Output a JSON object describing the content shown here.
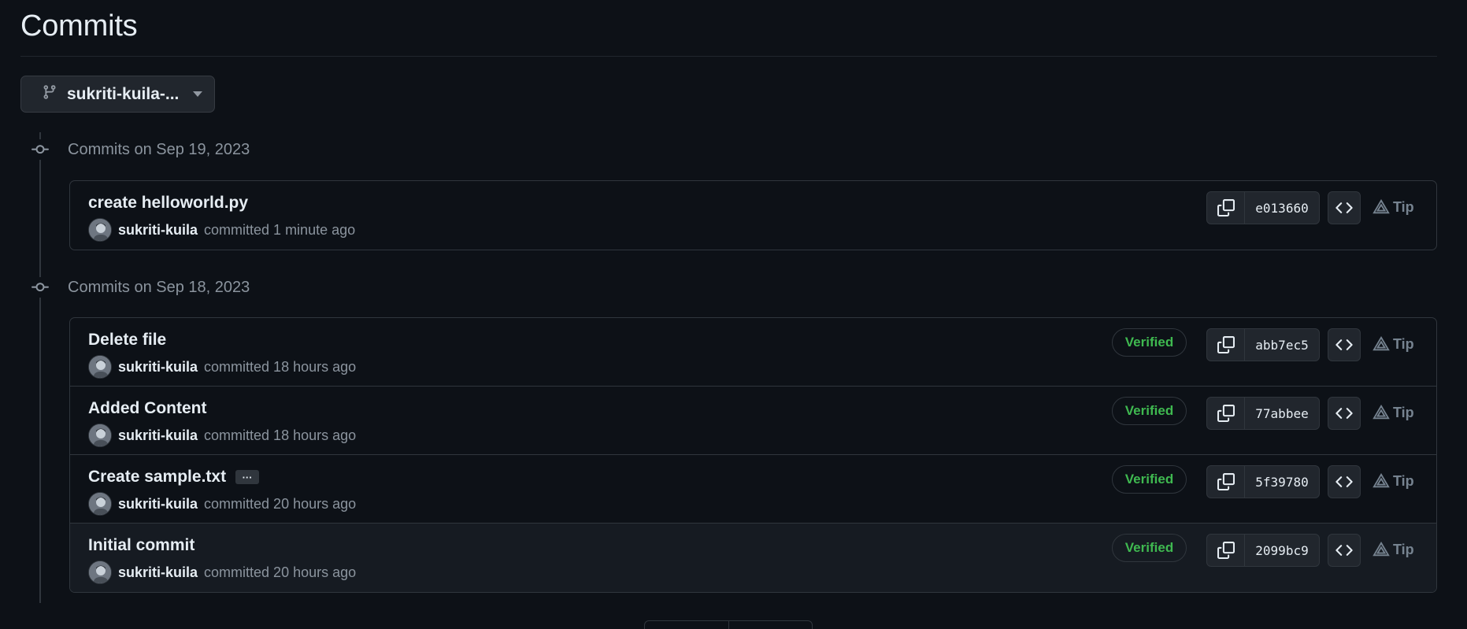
{
  "page": {
    "title": "Commits"
  },
  "branch": {
    "label": "sukriti-kuila-..."
  },
  "groups": [
    {
      "date": "Commits on Sep 19, 2023",
      "commits": [
        {
          "message": "create helloworld.py",
          "author": "sukriti-kuila",
          "time": "committed 1 minute ago",
          "verified": "",
          "sha": "e013660",
          "tip": "Tip"
        }
      ]
    },
    {
      "date": "Commits on Sep 18, 2023",
      "commits": [
        {
          "message": "Delete file",
          "author": "sukriti-kuila",
          "time": "committed 18 hours ago",
          "verified": "Verified",
          "sha": "abb7ec5",
          "tip": "Tip"
        },
        {
          "message": "Added Content",
          "author": "sukriti-kuila",
          "time": "committed 18 hours ago",
          "verified": "Verified",
          "sha": "77abbee",
          "tip": "Tip"
        },
        {
          "message": "Create sample.txt",
          "ellipsis": "···",
          "author": "sukriti-kuila",
          "time": "committed 20 hours ago",
          "verified": "Verified",
          "sha": "5f39780",
          "tip": "Tip"
        },
        {
          "message": "Initial commit",
          "author": "sukriti-kuila",
          "time": "committed 20 hours ago",
          "verified": "Verified",
          "sha": "2099bc9",
          "tip": "Tip"
        }
      ]
    }
  ],
  "colors": {
    "background": "#0d1117",
    "verified": "#3fb950",
    "muted": "#8b949e",
    "border": "#30363d"
  },
  "icons": [
    "git-branch-icon",
    "caret-down-icon",
    "git-commit-icon",
    "copy-icon",
    "code-icon",
    "triangle-warning-icon",
    "avatar"
  ]
}
